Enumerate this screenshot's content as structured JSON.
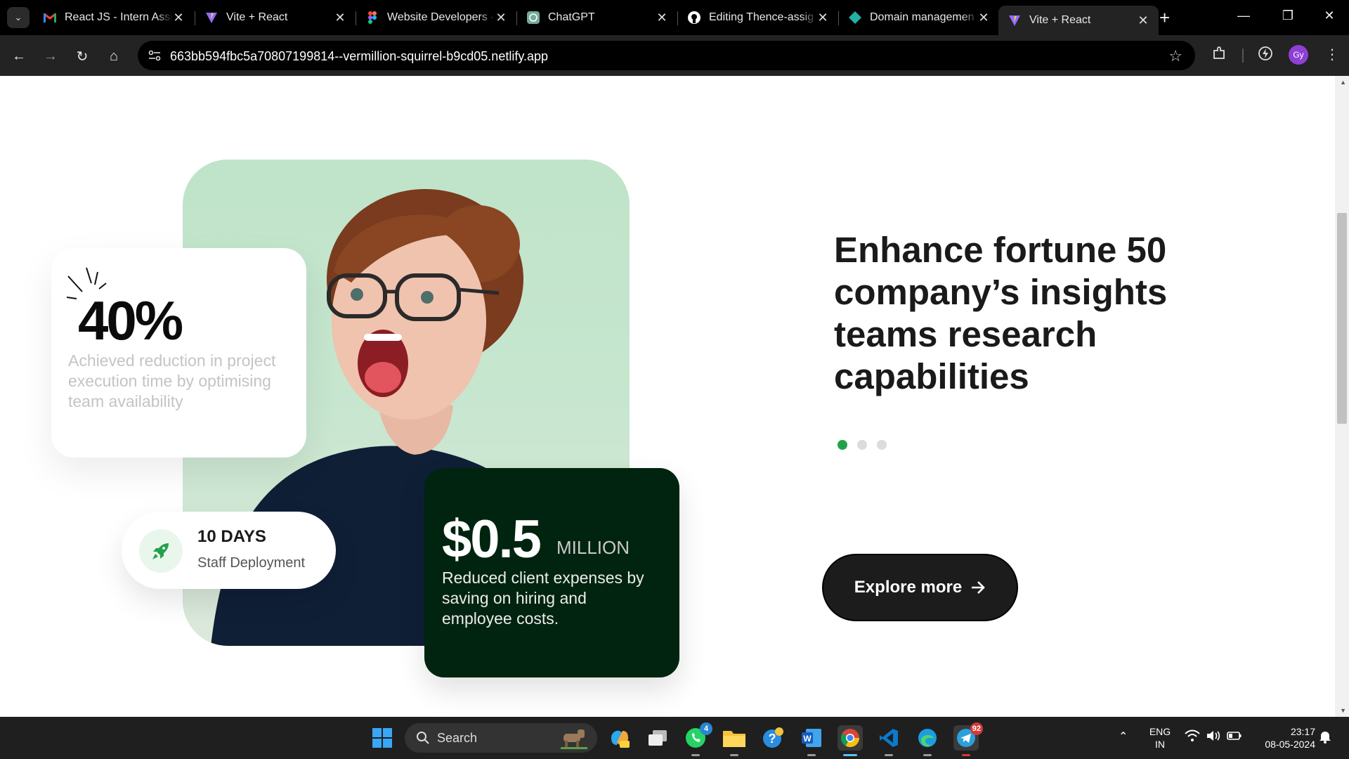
{
  "browser": {
    "tabs": [
      {
        "title": "React JS - Intern Assi",
        "icon": "gmail-icon",
        "active": false
      },
      {
        "title": "Vite + React",
        "icon": "vite-icon",
        "active": false
      },
      {
        "title": "Website Developers -",
        "icon": "figma-icon",
        "active": false
      },
      {
        "title": "ChatGPT",
        "icon": "chatgpt-icon",
        "active": false
      },
      {
        "title": "Editing Thence-assig",
        "icon": "github-icon",
        "active": false
      },
      {
        "title": "Domain managemen",
        "icon": "netlify-icon",
        "active": false
      },
      {
        "title": "Vite + React",
        "icon": "vite-icon",
        "active": true
      }
    ],
    "url": "663bb594fbc5a70807199814--vermillion-squirrel-b9cd05.netlify.app",
    "profile_initials": "Gy"
  },
  "page": {
    "stat_card": {
      "value": "40%",
      "description": "Achieved reduction in project execution time by optimising team availability"
    },
    "days_card": {
      "value": "10 DAYS",
      "label": "Staff Deployment"
    },
    "money_card": {
      "value": "$0.5",
      "unit": "MILLION",
      "description": "Reduced client expenses by saving on hiring and employee costs."
    },
    "headline": "Enhance fortune 50 company’s insights teams research capabilities",
    "carousel": {
      "count": 3,
      "active_index": 0
    },
    "cta_label": "Explore more",
    "colors": {
      "accent_green": "#22a14b",
      "dark_green": "#00240f",
      "cta_dark": "#1c1c1c"
    }
  },
  "taskbar": {
    "search_placeholder": "Search",
    "apps": [
      {
        "name": "copilot",
        "badge": ""
      },
      {
        "name": "file-explorer-stack",
        "badge": ""
      },
      {
        "name": "whatsapp",
        "badge": "4"
      },
      {
        "name": "file-explorer",
        "badge": ""
      },
      {
        "name": "help",
        "badge": ""
      },
      {
        "name": "word",
        "badge": ""
      },
      {
        "name": "chrome",
        "badge": ""
      },
      {
        "name": "vscode",
        "badge": ""
      },
      {
        "name": "edge",
        "badge": ""
      },
      {
        "name": "telegram",
        "badge": "92"
      }
    ],
    "language_top": "ENG",
    "language_bottom": "IN",
    "time": "23:17",
    "date": "08-05-2024"
  }
}
